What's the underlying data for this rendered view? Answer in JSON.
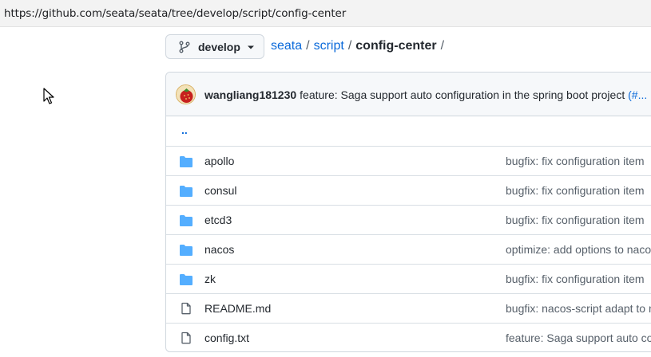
{
  "browser": {
    "url": "https://github.com/seata/seata/tree/develop/script/config-center"
  },
  "branch": {
    "label": "develop"
  },
  "breadcrumb": {
    "repo": "seata",
    "sep1": "/",
    "folder": "script",
    "sep2": "/",
    "current": "config-center",
    "sep3": "/"
  },
  "commit": {
    "author": "wangliang181230",
    "message": "feature: Saga support auto configuration in the spring boot project",
    "link_prefix": "(",
    "link": "#..."
  },
  "parent_dir": "..",
  "files": [
    {
      "type": "dir",
      "icon": "folder-icon",
      "name": "apollo",
      "message": "bugfix: fix configuration item"
    },
    {
      "type": "dir",
      "icon": "folder-icon",
      "name": "consul",
      "message": "bugfix: fix configuration item"
    },
    {
      "type": "dir",
      "icon": "folder-icon",
      "name": "etcd3",
      "message": "bugfix: fix configuration item"
    },
    {
      "type": "dir",
      "icon": "folder-icon",
      "name": "nacos",
      "message": "optimize: add options to naco"
    },
    {
      "type": "dir",
      "icon": "folder-icon",
      "name": "zk",
      "message": "bugfix: fix configuration item"
    },
    {
      "type": "file",
      "icon": "file-icon",
      "name": "README.md",
      "message": "bugfix: nacos-script adapt to n"
    },
    {
      "type": "file",
      "icon": "file-icon",
      "name": "config.txt",
      "message": "feature: Saga support auto co"
    }
  ],
  "colors": {
    "link": "#0969da",
    "folder": "#54aeff",
    "muted": "#57606a"
  }
}
